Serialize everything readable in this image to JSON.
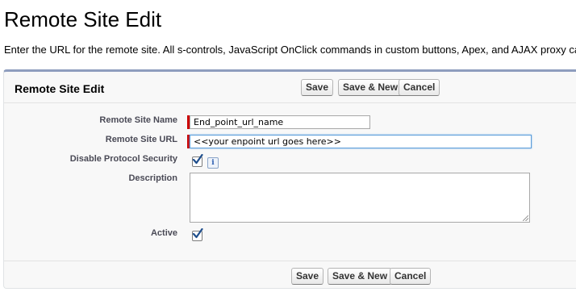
{
  "page": {
    "title": "Remote Site Edit",
    "intro": "Enter the URL for the remote site. All s-controls, JavaScript OnClick commands in custom buttons, Apex, and AJAX proxy calls"
  },
  "panel": {
    "title": "Remote Site Edit",
    "buttons": {
      "save": "Save",
      "save_new": "Save & New",
      "cancel": "Cancel"
    }
  },
  "form": {
    "remote_site_name": {
      "label": "Remote Site Name",
      "value": "End_point_url_name"
    },
    "remote_site_url": {
      "label": "Remote Site URL",
      "value": "<<your enpoint url goes here>>"
    },
    "disable_protocol_security": {
      "label": "Disable Protocol Security",
      "checked": true,
      "info_icon": "i"
    },
    "description": {
      "label": "Description",
      "value": ""
    },
    "active": {
      "label": "Active",
      "checked": true
    }
  },
  "colors": {
    "required": "#cc0000",
    "panel_border_top": "#8e9dbe",
    "focus": "#5b9dd9"
  }
}
